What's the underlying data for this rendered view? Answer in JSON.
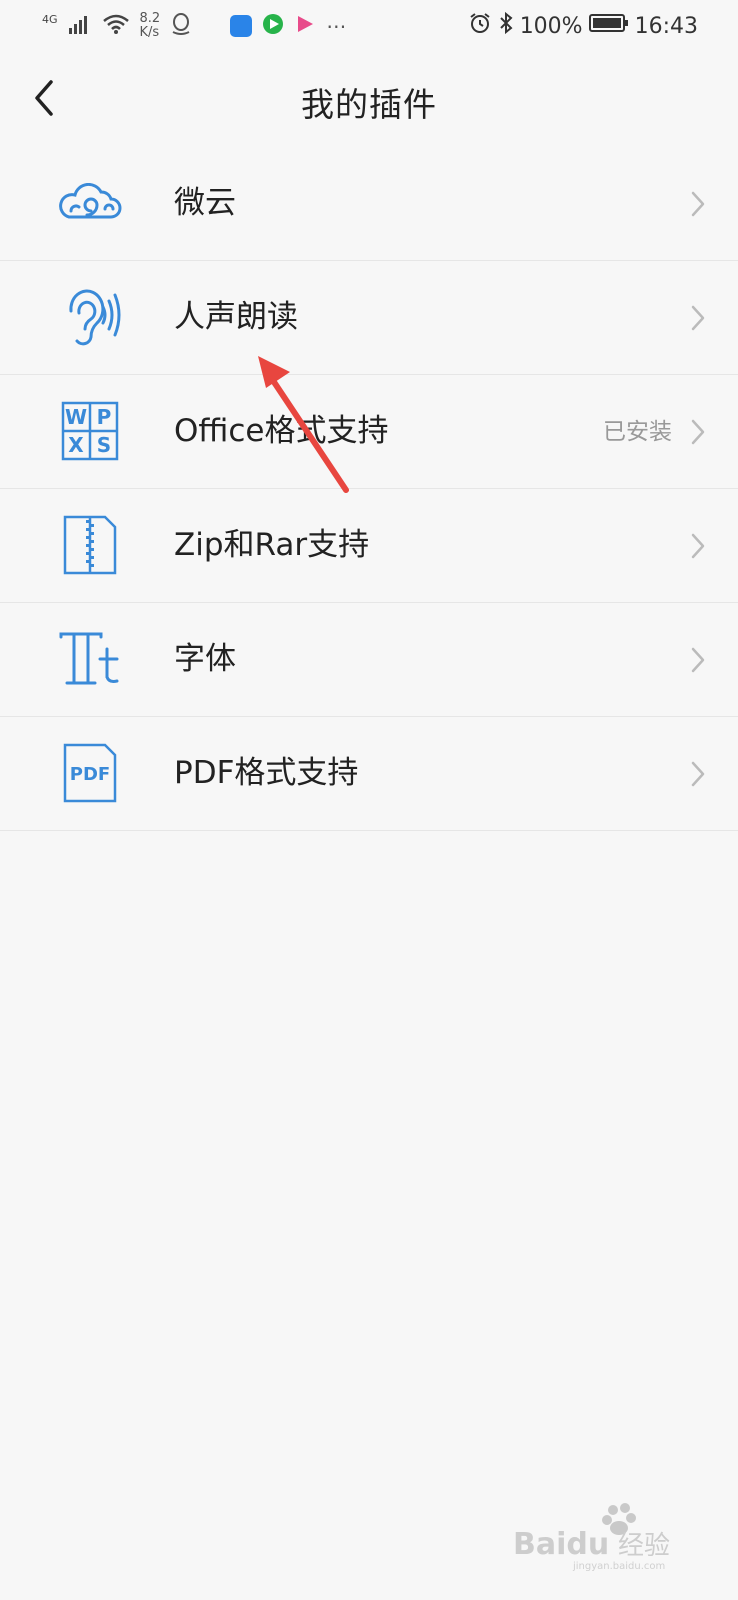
{
  "status_bar": {
    "network": "4G",
    "speed_value": "8.2",
    "speed_unit": "K/s",
    "battery": "100%",
    "time": "16:43",
    "icons": [
      "signal-icon",
      "wifi-icon",
      "qq-icon",
      "app-icon",
      "video-icon",
      "play-icon",
      "more-icon",
      "alarm-icon",
      "bluetooth-icon",
      "battery-icon"
    ]
  },
  "header": {
    "title": "我的插件",
    "back_icon": "chevron-left-icon"
  },
  "plugins": [
    {
      "name": "微云",
      "icon": "cloud-icon",
      "status": ""
    },
    {
      "name": "人声朗读",
      "icon": "ear-sound-icon",
      "status": ""
    },
    {
      "name": "Office格式支持",
      "icon": "wps-icon",
      "status": "已安装"
    },
    {
      "name": "Zip和Rar支持",
      "icon": "zip-file-icon",
      "status": ""
    },
    {
      "name": "字体",
      "icon": "font-icon",
      "status": ""
    },
    {
      "name": "PDF格式支持",
      "icon": "pdf-file-icon",
      "status": ""
    }
  ],
  "colors": {
    "accent": "#3a8ad8",
    "background": "#f7f7f7",
    "annotation_arrow": "#e8463f"
  },
  "watermark": {
    "brand": "Baidu",
    "cn": "经验",
    "url": "jingyan.baidu.com"
  }
}
